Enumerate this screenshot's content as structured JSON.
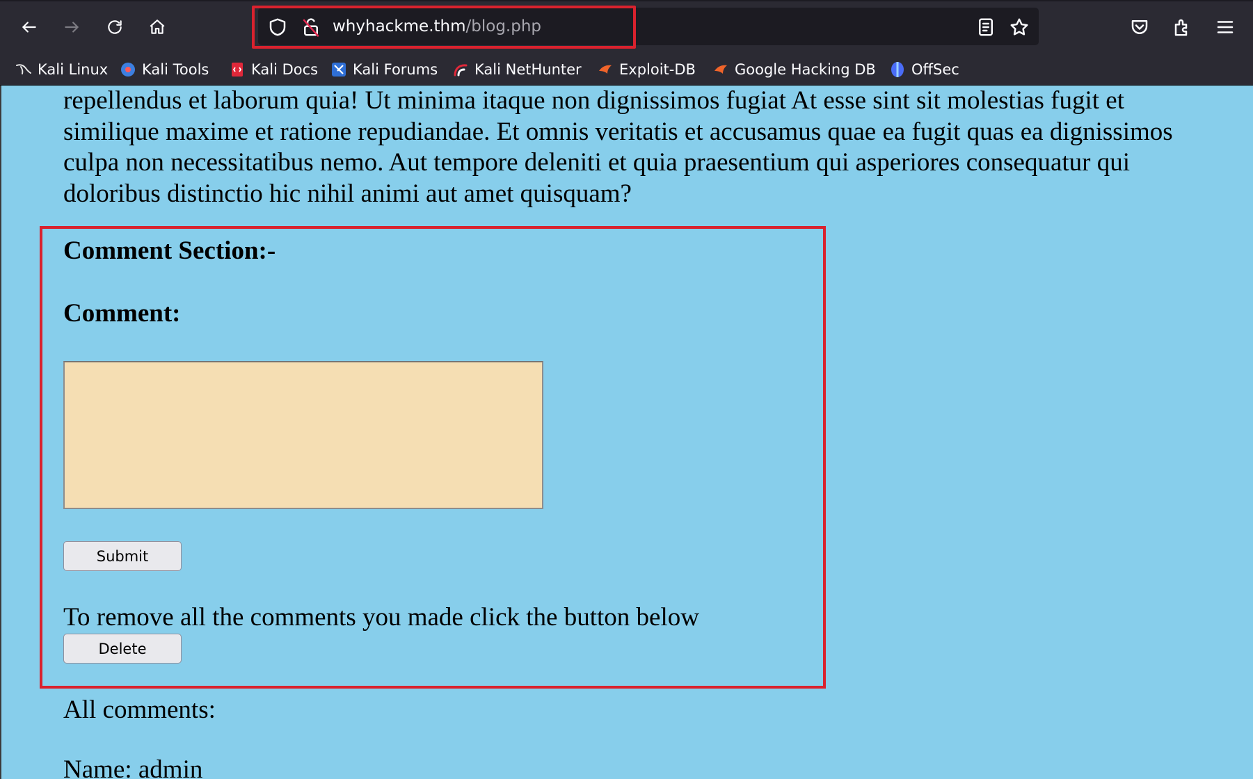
{
  "browser": {
    "url_host": "whyhackme.thm",
    "url_path": "/blog.php",
    "bookmarks": [
      {
        "label": "Kali Linux",
        "icon": "kali-dragon-icon"
      },
      {
        "label": "Kali Tools",
        "icon": "kali-tools-icon"
      },
      {
        "label": "Kali Docs",
        "icon": "kali-docs-icon"
      },
      {
        "label": "Kali Forums",
        "icon": "kali-forums-icon"
      },
      {
        "label": "Kali NetHunter",
        "icon": "kali-nethunter-icon"
      },
      {
        "label": "Exploit-DB",
        "icon": "exploit-db-icon"
      },
      {
        "label": "Google Hacking DB",
        "icon": "google-hacking-db-icon"
      },
      {
        "label": "OffSec",
        "icon": "offsec-icon"
      }
    ]
  },
  "page": {
    "intro_text": "repellendus et laborum quia! Ut minima itaque non dignissimos fugiat At esse sint sit molestias fugit et similique maxime et ratione repudiandae. Et omnis veritatis et accusamus quae ea fugit quas ea dignissimos culpa non necessitatibus nemo. Aut tempore deleniti et quia praesentium qui asperiores consequatur qui doloribus distinctio hic nihil animi aut amet quisquam?",
    "comment_section_heading": "Comment Section:-",
    "comment_label": "Comment:",
    "comment_value": "",
    "submit_label": "Submit",
    "remove_text": "To remove all the comments you made click the button below",
    "delete_label": "Delete",
    "all_comments_heading": "All comments:",
    "first_comment_name": "Name: admin"
  },
  "colors": {
    "page_background": "#87ceeb",
    "textarea_background": "#f5deb3",
    "highlight_red": "#d9222e",
    "browser_chrome": "#2b2a33"
  }
}
